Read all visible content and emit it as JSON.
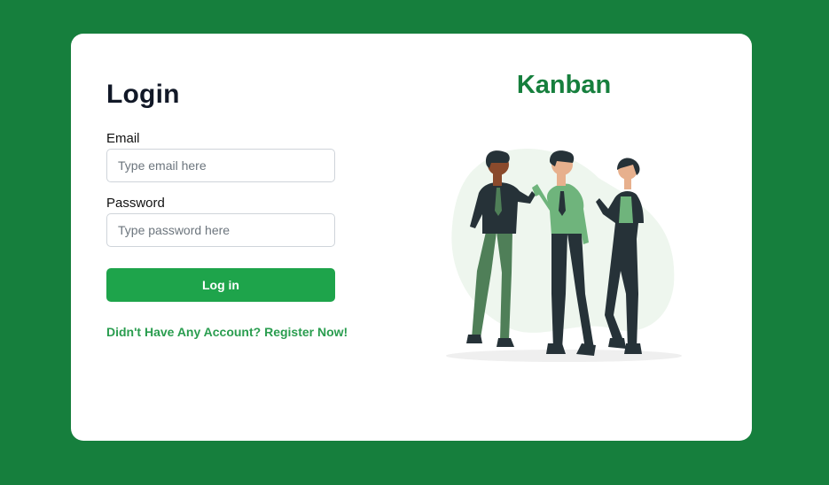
{
  "login": {
    "title": "Login",
    "email_label": "Email",
    "email_placeholder": "Type email here",
    "email_value": "",
    "password_label": "Password",
    "password_placeholder": "Type password here",
    "password_value": "",
    "submit_label": "Log in",
    "register_link": "Didn't Have Any Account? Register Now!"
  },
  "brand": {
    "title": "Kanban"
  },
  "illustration": {
    "icon": "team-people-illustration"
  },
  "colors": {
    "background": "#167f3d",
    "card": "#ffffff",
    "accent": "#1ea44b",
    "brand": "#167f3d",
    "link": "#2a9d4f"
  }
}
